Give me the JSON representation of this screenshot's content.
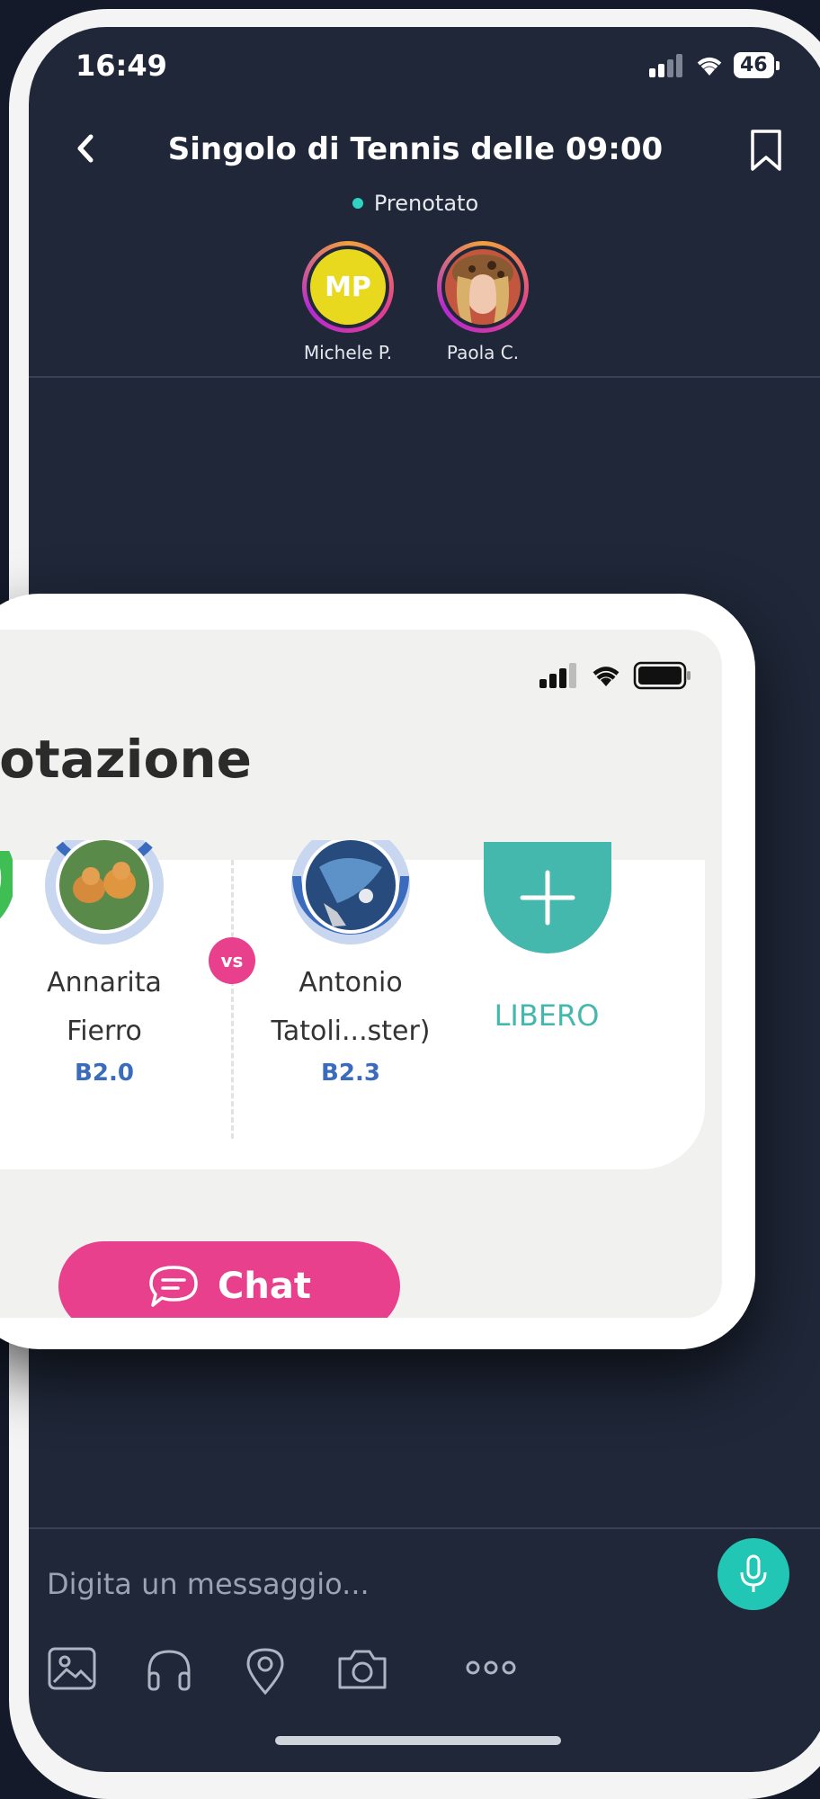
{
  "status_bar": {
    "time": "16:49",
    "battery": "46"
  },
  "header": {
    "title": "Singolo di Tennis delle 09:00",
    "status": "Prenotato"
  },
  "participants": [
    {
      "initials": "MP",
      "name": "Michele P."
    },
    {
      "initials": "",
      "name": "Paola C."
    }
  ],
  "composer": {
    "placeholder": "Digita un messaggio..."
  },
  "overlay": {
    "heading": "enotazione",
    "vs_label": "vs",
    "players": [
      {
        "name_line1": "Annarita",
        "name_line2": "Fierro",
        "level": "B2.0"
      },
      {
        "name_line1": "Antonio",
        "name_line2": "Tatoli...ster)",
        "level": "B2.3"
      }
    ],
    "free_slot_label": "LIBERO",
    "chat_button": "Chat"
  },
  "colors": {
    "accent_pink": "#e8408c",
    "accent_teal": "#21c6b4",
    "dark_bg": "#1f2738"
  }
}
